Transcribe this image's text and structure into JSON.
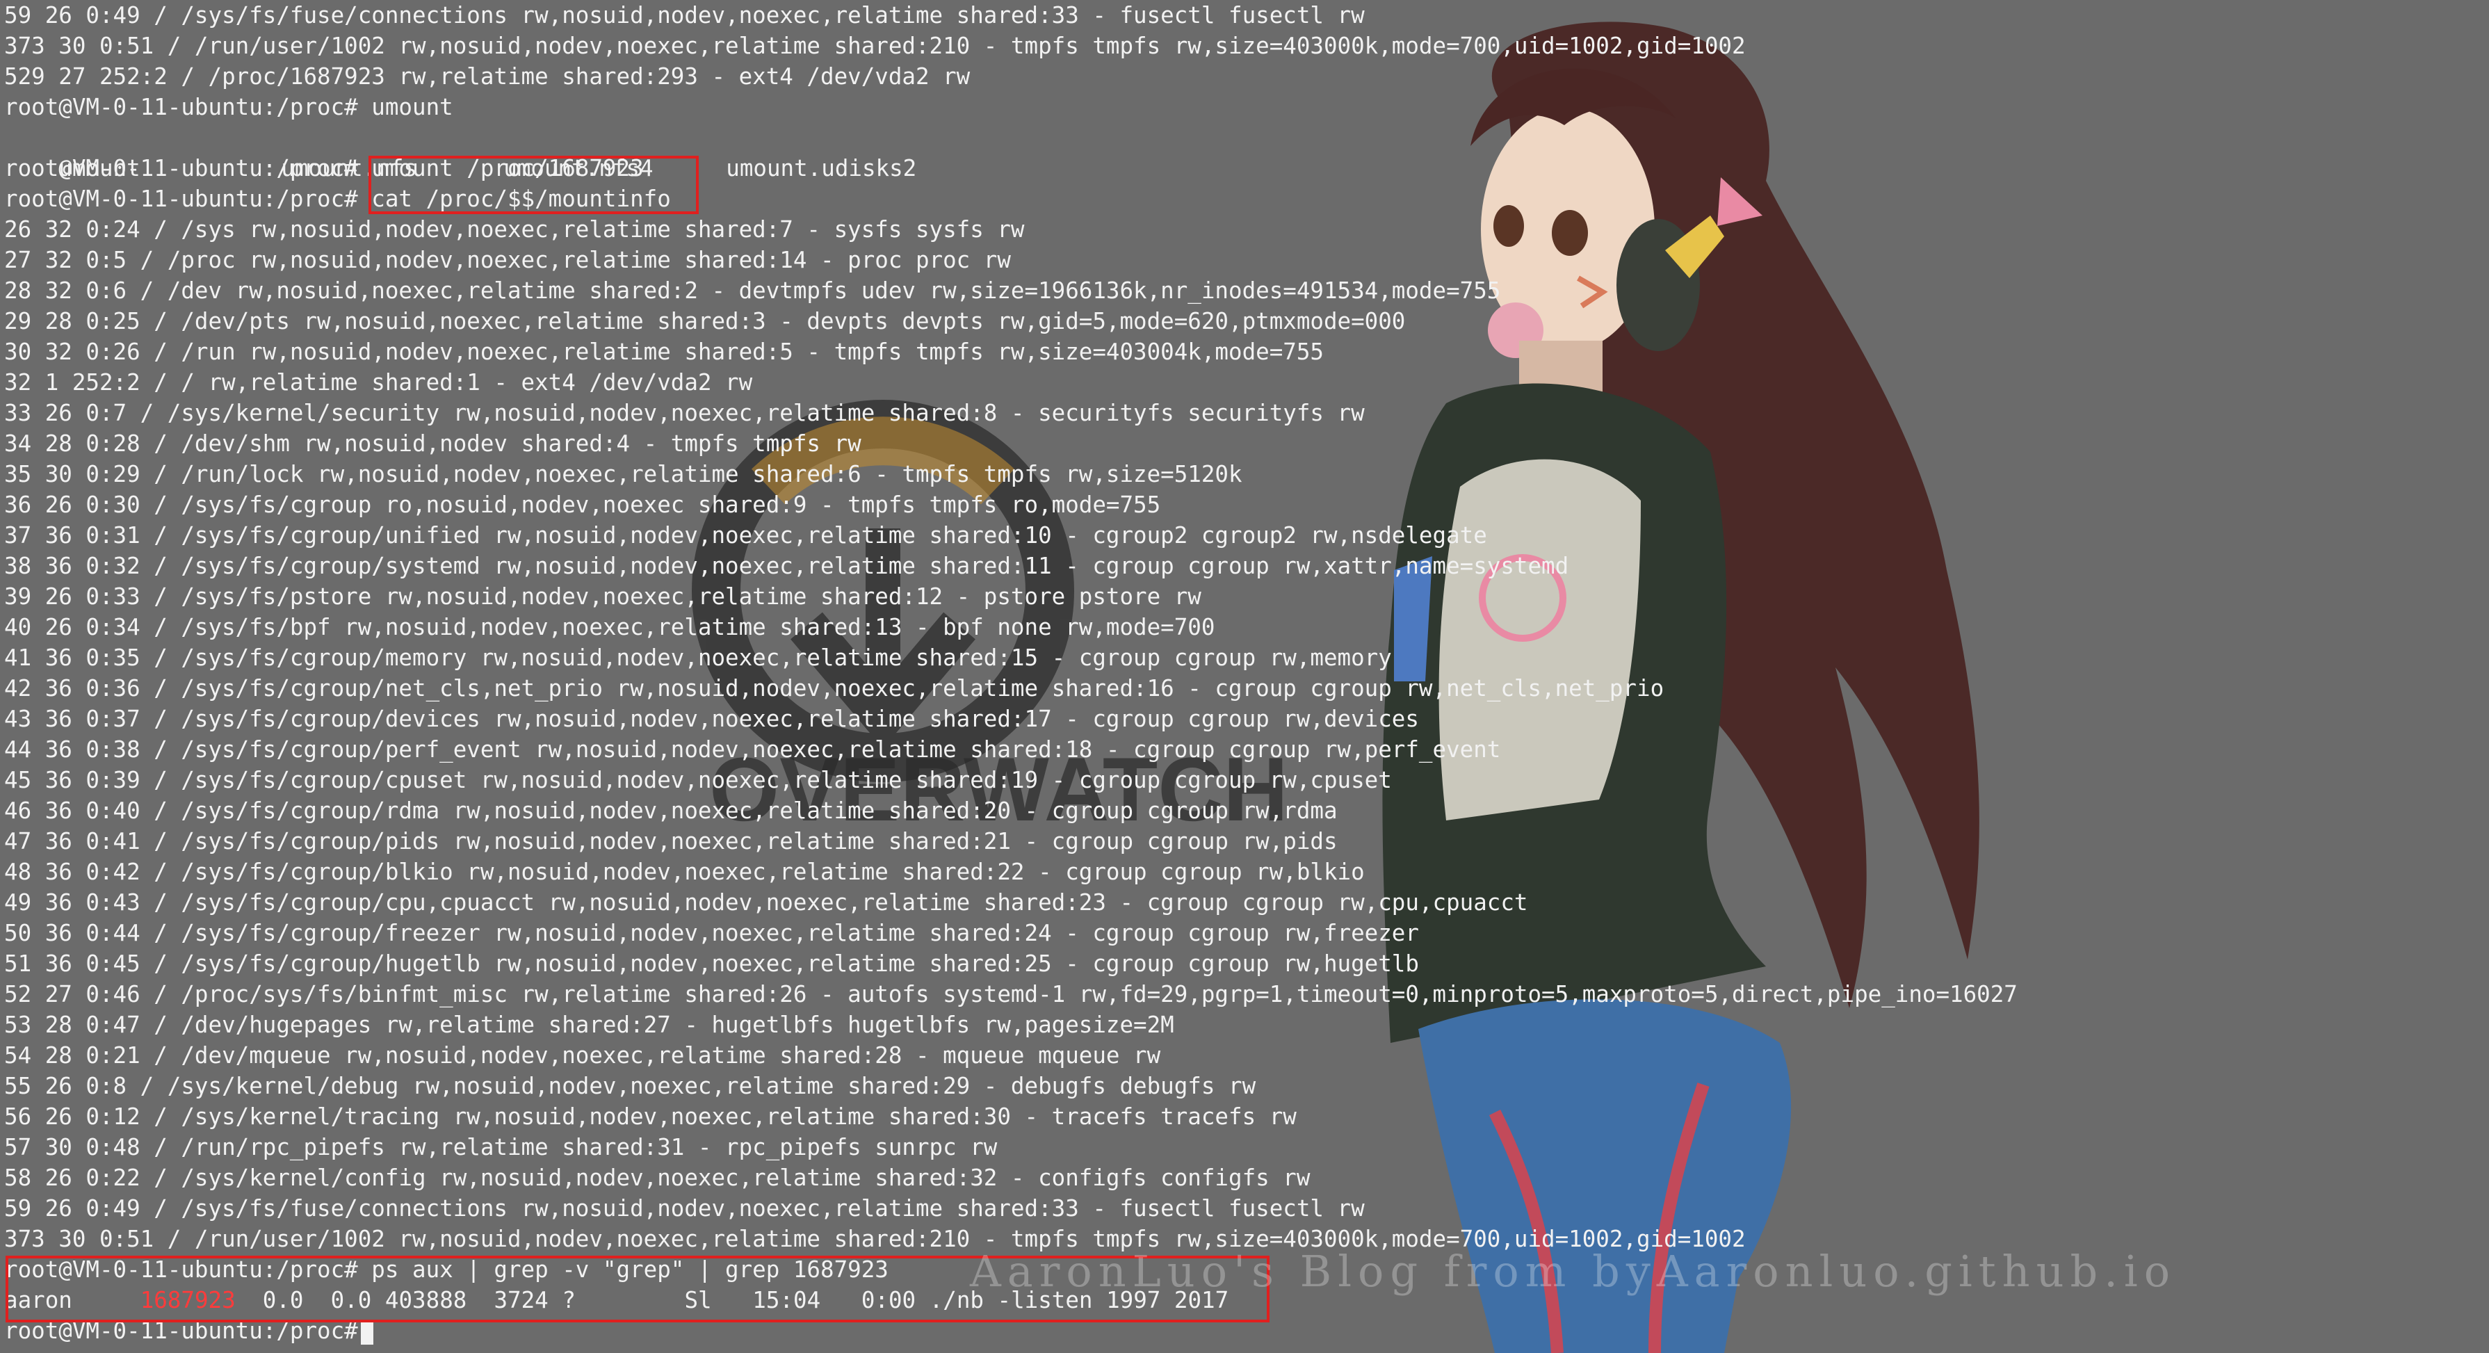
{
  "terminal": {
    "prompt": "root@VM-0-11-ubuntu:/proc#",
    "lines": [
      "59 26 0:49 / /sys/fs/fuse/connections rw,nosuid,nodev,noexec,relatime shared:33 - fusectl fusectl rw",
      "373 30 0:51 / /run/user/1002 rw,nosuid,nodev,noexec,relatime shared:210 - tmpfs tmpfs rw,size=403000k,mode=700,uid=1002,gid=1002",
      "529 27 252:2 / /proc/1687923 rw,relatime shared:293 - ext4 /dev/vda2 rw",
      "root@VM-0-11-ubuntu:/proc# umount",
      null,
      "root@VM-0-11-ubuntu:/proc# umount /proc/1687923",
      "root@VM-0-11-ubuntu:/proc# cat /proc/$$/mountinfo",
      "26 32 0:24 / /sys rw,nosuid,nodev,noexec,relatime shared:7 - sysfs sysfs rw",
      "27 32 0:5 / /proc rw,nosuid,nodev,noexec,relatime shared:14 - proc proc rw",
      "28 32 0:6 / /dev rw,nosuid,noexec,relatime shared:2 - devtmpfs udev rw,size=1966136k,nr_inodes=491534,mode=755",
      "29 28 0:25 / /dev/pts rw,nosuid,noexec,relatime shared:3 - devpts devpts rw,gid=5,mode=620,ptmxmode=000",
      "30 32 0:26 / /run rw,nosuid,nodev,noexec,relatime shared:5 - tmpfs tmpfs rw,size=403004k,mode=755",
      "32 1 252:2 / / rw,relatime shared:1 - ext4 /dev/vda2 rw",
      "33 26 0:7 / /sys/kernel/security rw,nosuid,nodev,noexec,relatime shared:8 - securityfs securityfs rw",
      "34 28 0:28 / /dev/shm rw,nosuid,nodev shared:4 - tmpfs tmpfs rw",
      "35 30 0:29 / /run/lock rw,nosuid,nodev,noexec,relatime shared:6 - tmpfs tmpfs rw,size=5120k",
      "36 26 0:30 / /sys/fs/cgroup ro,nosuid,nodev,noexec shared:9 - tmpfs tmpfs ro,mode=755",
      "37 36 0:31 / /sys/fs/cgroup/unified rw,nosuid,nodev,noexec,relatime shared:10 - cgroup2 cgroup2 rw,nsdelegate",
      "38 36 0:32 / /sys/fs/cgroup/systemd rw,nosuid,nodev,noexec,relatime shared:11 - cgroup cgroup rw,xattr,name=systemd",
      "39 26 0:33 / /sys/fs/pstore rw,nosuid,nodev,noexec,relatime shared:12 - pstore pstore rw",
      "40 26 0:34 / /sys/fs/bpf rw,nosuid,nodev,noexec,relatime shared:13 - bpf none rw,mode=700",
      "41 36 0:35 / /sys/fs/cgroup/memory rw,nosuid,nodev,noexec,relatime shared:15 - cgroup cgroup rw,memory",
      "42 36 0:36 / /sys/fs/cgroup/net_cls,net_prio rw,nosuid,nodev,noexec,relatime shared:16 - cgroup cgroup rw,net_cls,net_prio",
      "43 36 0:37 / /sys/fs/cgroup/devices rw,nosuid,nodev,noexec,relatime shared:17 - cgroup cgroup rw,devices",
      "44 36 0:38 / /sys/fs/cgroup/perf_event rw,nosuid,nodev,noexec,relatime shared:18 - cgroup cgroup rw,perf_event",
      "45 36 0:39 / /sys/fs/cgroup/cpuset rw,nosuid,nodev,noexec,relatime shared:19 - cgroup cgroup rw,cpuset",
      "46 36 0:40 / /sys/fs/cgroup/rdma rw,nosuid,nodev,noexec,relatime shared:20 - cgroup cgroup rw,rdma",
      "47 36 0:41 / /sys/fs/cgroup/pids rw,nosuid,nodev,noexec,relatime shared:21 - cgroup cgroup rw,pids",
      "48 36 0:42 / /sys/fs/cgroup/blkio rw,nosuid,nodev,noexec,relatime shared:22 - cgroup cgroup rw,blkio",
      "49 36 0:43 / /sys/fs/cgroup/cpu,cpuacct rw,nosuid,nodev,noexec,relatime shared:23 - cgroup cgroup rw,cpu,cpuacct",
      "50 36 0:44 / /sys/fs/cgroup/freezer rw,nosuid,nodev,noexec,relatime shared:24 - cgroup cgroup rw,freezer",
      "51 36 0:45 / /sys/fs/cgroup/hugetlb rw,nosuid,nodev,noexec,relatime shared:25 - cgroup cgroup rw,hugetlb",
      "52 27 0:46 / /proc/sys/fs/binfmt_misc rw,relatime shared:26 - autofs systemd-1 rw,fd=29,pgrp=1,timeout=0,minproto=5,maxproto=5,direct,pipe_ino=16027",
      "53 28 0:47 / /dev/hugepages rw,relatime shared:27 - hugetlbfs hugetlbfs rw,pagesize=2M",
      "54 28 0:21 / /dev/mqueue rw,nosuid,nodev,noexec,relatime shared:28 - mqueue mqueue rw",
      "55 26 0:8 / /sys/kernel/debug rw,nosuid,nodev,noexec,relatime shared:29 - debugfs debugfs rw",
      "56 26 0:12 / /sys/kernel/tracing rw,nosuid,nodev,noexec,relatime shared:30 - tracefs tracefs rw",
      "57 30 0:48 / /run/rpc_pipefs rw,relatime shared:31 - rpc_pipefs sunrpc rw",
      "58 26 0:22 / /sys/kernel/config rw,nosuid,nodev,noexec,relatime shared:32 - configfs configfs rw",
      "59 26 0:49 / /sys/fs/fuse/connections rw,nosuid,nodev,noexec,relatime shared:33 - fusectl fusectl rw",
      "373 30 0:51 / /run/user/1002 rw,nosuid,nodev,noexec,relatime shared:210 - tmpfs tmpfs rw,size=403000k,mode=700,uid=1002,gid=1002",
      "root@VM-0-11-ubuntu:/proc# ps aux | grep -v \"grep\" | grep 1687923",
      null,
      null
    ],
    "completions": [
      "umount",
      "umount.nfs",
      "umount.nfs4",
      "umount.udisks2"
    ],
    "ps_row": {
      "user": "aaron",
      "pid": "1687923",
      "cpu": "0.0",
      "mem": "0.0",
      "vsz": "403888",
      "rss": "3724",
      "tty": "?",
      "stat": "Sl",
      "start": "15:04",
      "time": "0:00",
      "command": "./nb -listen 1997 2017"
    },
    "last_prompt": "root@VM-0-11-ubuntu:/proc#"
  },
  "wallpaper": {
    "logo_text": "OVERWATCH",
    "watermark": "AaronLuo's Blog from byAaronluo.github.io"
  },
  "colors": {
    "background": "#6b6b6b",
    "text": "#f2f2f2",
    "highlight_box": "#e0201f",
    "pid": "#ff3b3b",
    "logo_ring": "#2b2b2b",
    "logo_accent": "#e39a1c"
  }
}
